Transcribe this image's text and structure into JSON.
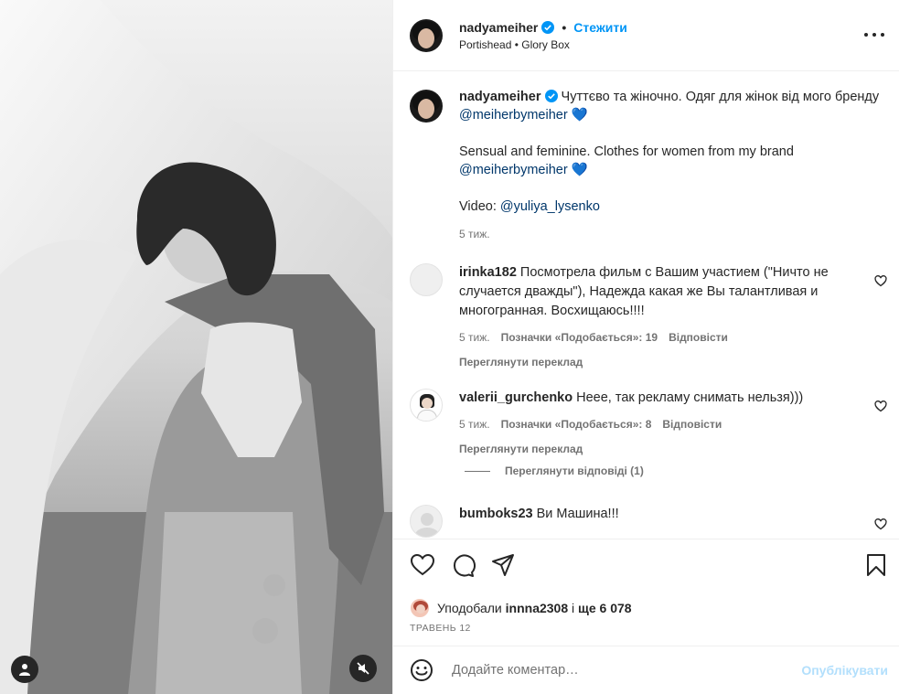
{
  "header": {
    "username": "nadyameiher",
    "separator": "•",
    "follow_label": "Стежити",
    "audio": "Portishead • Glory Box"
  },
  "caption": {
    "username": "nadyameiher",
    "text_ua": "Чуттєво та жіночно. Одяг для жінок від мого бренду",
    "mention1": "@meiherbymeiher",
    "heart": "💙",
    "text_en": "Sensual and feminine. Clothes for women from my brand",
    "mention2": "@meiherbymeiher",
    "video_label": "Video:",
    "video_mention": "@yuliya_lysenko",
    "time": "5 тиж."
  },
  "comments": [
    {
      "username": "irinka182",
      "text": "Посмотрела фильм с Вашим участием (\"Ничто не случается дважды\"), Надежда какая же Вы талантливая и многогранная. Восхищаюсь!!!!",
      "time": "5 тиж.",
      "likes": "Позначки «Подобається»: 19",
      "reply": "Відповісти",
      "translate": "Переглянути переклад"
    },
    {
      "username": "valerii_gurchenko",
      "text": "Неее, так рекламу снимать нельзя)))",
      "time": "5 тиж.",
      "likes": "Позначки «Подобається»: 8",
      "reply": "Відповісти",
      "translate": "Переглянути переклад",
      "view_replies": "Переглянути відповіді (1)"
    },
    {
      "username": "bumboks23",
      "text": "Ви Машина!!!"
    }
  ],
  "likes": {
    "prefix": "Уподобали",
    "user": "innna2308",
    "middle": "і",
    "count": "ще 6 078"
  },
  "date": "ТРАВЕНЬ 12",
  "add_comment": {
    "placeholder": "Додайте коментар…",
    "publish": "Опублікувати"
  },
  "icons": {
    "verified": "verified-badge-icon",
    "more": "more-options-icon",
    "like": "heart-icon",
    "comment": "comment-icon",
    "share": "share-icon",
    "save": "bookmark-icon",
    "emoji": "emoji-icon",
    "mute": "muted-speaker-icon",
    "tag": "user-tag-icon"
  },
  "colors": {
    "link_blue": "#0095f6",
    "mention": "#00376b",
    "muted_text": "#737373",
    "publish_disabled": "#b2dffc"
  }
}
